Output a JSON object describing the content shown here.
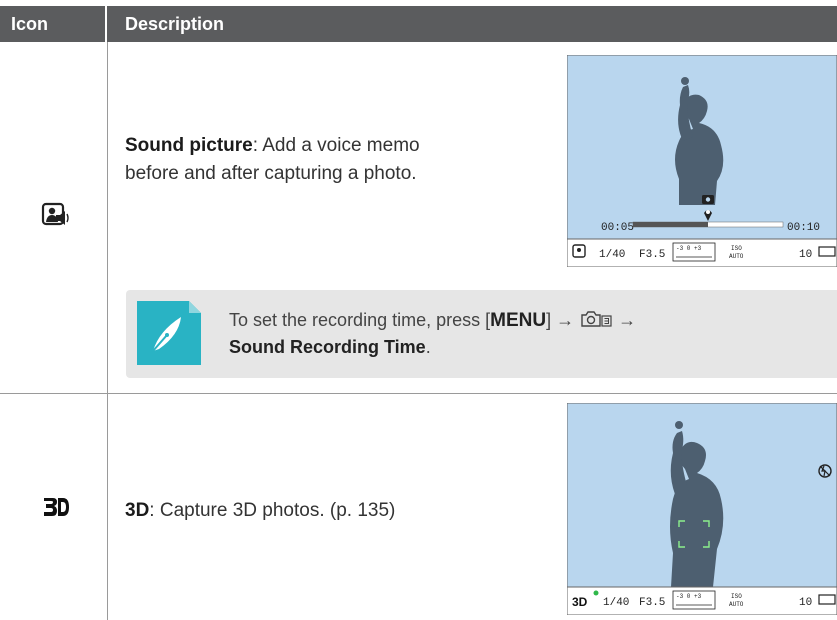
{
  "header": {
    "col1": "Icon",
    "col2": "Description"
  },
  "rows": [
    {
      "icon": "sound-picture-icon",
      "title": "Sound picture",
      "sep": ":",
      "line1": " Add a voice memo",
      "line2": "before and after capturing a photo.",
      "screen": {
        "time_start": "00:05",
        "time_end": "00:10",
        "shutter": "1/40",
        "aperture": "F3.5",
        "ev_scale": "-3  0  +3",
        "iso_top": "ISO",
        "iso_bottom": "AUTO",
        "shots": "10",
        "progress": 0.5
      }
    },
    {
      "icon": "3d-icon",
      "title": "3D",
      "sep": ":",
      "line1": " Capture 3D photos. (p. 135)",
      "screen": {
        "shutter": "1/40",
        "aperture": "F3.5",
        "ev_scale": "-3  0  +3",
        "iso_top": "ISO",
        "iso_bottom": "AUTO",
        "shots": "10"
      }
    }
  ],
  "note": {
    "line1_pre": "To set the recording time, press [",
    "menu": "MENU",
    "line1_post": "] →",
    "arrow2": "→",
    "line2": "Sound Recording Time",
    "line2_end": "."
  },
  "colors": {
    "header_bg": "#5b5c5e",
    "note_bg": "#e6e6e6",
    "sky": "#b9d6ee",
    "silhouette": "#4d5f70",
    "note_icon": "#29b3c4"
  }
}
